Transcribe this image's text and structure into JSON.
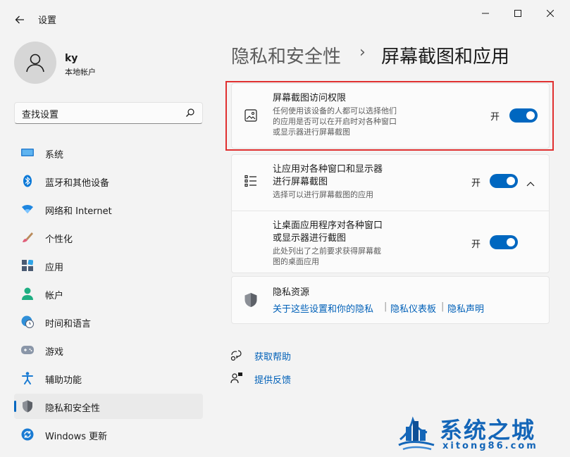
{
  "window": {
    "app_title": "设置"
  },
  "profile": {
    "name": "ky",
    "account_type": "本地帐户"
  },
  "search": {
    "placeholder": "查找设置"
  },
  "sidebar": {
    "items": [
      {
        "label": "系统",
        "icon": "monitor-icon"
      },
      {
        "label": "蓝牙和其他设备",
        "icon": "bluetooth-icon"
      },
      {
        "label": "网络和 Internet",
        "icon": "wifi-icon"
      },
      {
        "label": "个性化",
        "icon": "brush-icon"
      },
      {
        "label": "应用",
        "icon": "apps-icon"
      },
      {
        "label": "帐户",
        "icon": "person-icon"
      },
      {
        "label": "时间和语言",
        "icon": "clock-globe-icon"
      },
      {
        "label": "游戏",
        "icon": "gamepad-icon"
      },
      {
        "label": "辅助功能",
        "icon": "accessibility-icon"
      },
      {
        "label": "隐私和安全性",
        "icon": "shield-icon"
      },
      {
        "label": "Windows 更新",
        "icon": "update-icon"
      }
    ],
    "active_index": 9
  },
  "breadcrumb": {
    "parent": "隐私和安全性",
    "separator": "›",
    "current": "屏幕截图和应用"
  },
  "settings": {
    "screenshot_access": {
      "title": "屏幕截图访问权限",
      "desc_line1": "任何使用该设备的人都可以选择他们",
      "desc_line2": "的应用是否可以在开启时对各种窗口",
      "desc_line3": "或显示器进行屏幕截图",
      "state_label": "开",
      "on": true
    },
    "apps_screenshot": {
      "title_line1": "让应用对各种窗口和显示器",
      "title_line2": "进行屏幕截图",
      "desc": "选择可以进行屏幕截图的应用",
      "state_label": "开",
      "on": true,
      "expanded": true
    },
    "desktop_apps_screenshot": {
      "title_line1": "让桌面应用程序对各种窗口",
      "title_line2": "或显示器进行截图",
      "desc_line1": "此处列出了之前要求获得屏幕截",
      "desc_line2": "图的桌面应用",
      "state_label": "开",
      "on": true
    }
  },
  "privacy_resources": {
    "title": "隐私资源",
    "links": [
      "关于这些设置和你的隐私",
      "隐私仪表板",
      "隐私声明"
    ],
    "separator": "|"
  },
  "help": {
    "get_help": "获取帮助",
    "feedback": "提供反馈"
  },
  "watermark": {
    "main": "系统之城",
    "sub": "xitong86.com"
  },
  "colors": {
    "accent": "#0067c0",
    "highlight_border": "#e03030",
    "link": "#0060b8"
  }
}
